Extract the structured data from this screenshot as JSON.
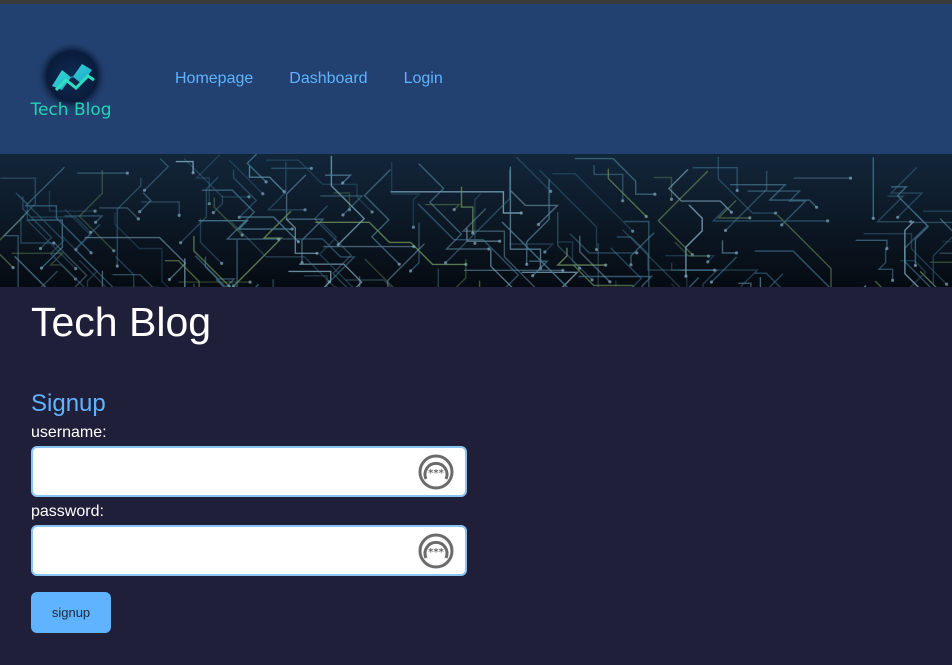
{
  "nav": {
    "logo_text": "Tech Blog",
    "links": [
      "Homepage",
      "Dashboard",
      "Login"
    ]
  },
  "main": {
    "title": "Tech Blog",
    "form": {
      "heading": "Signup",
      "username_label": "username:",
      "username_value": "",
      "password_label": "password:",
      "password_value": "",
      "submit_label": "signup"
    }
  },
  "colors": {
    "navbar_bg": "#234170",
    "page_bg": "#1f1f3a",
    "accent": "#5fb3ff",
    "logo_teal": "#22d3b4"
  }
}
